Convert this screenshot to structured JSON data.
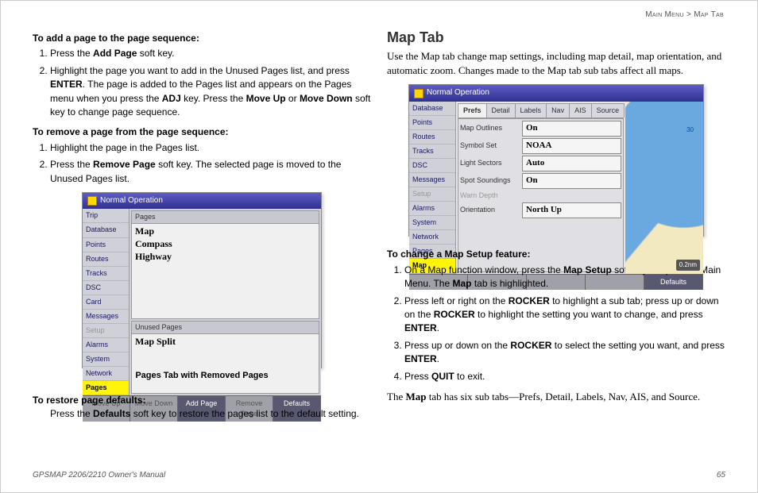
{
  "breadcrumb": {
    "left": "Main Menu",
    "sep": ">",
    "right": "Map Tab"
  },
  "left": {
    "addHead": "To add a page to the page sequence:",
    "add1_pre": "Press the ",
    "add1_b": "Add Page",
    "add1_post": " soft key.",
    "add2_a": "Highlight the page you want to add in the Unused Pages list, and press ",
    "add2_b": "ENTER",
    "add2_c": ". The page is added to the Pages list and appears on the Pages menu when you press the ",
    "add2_d": "ADJ",
    "add2_e": " key. Press the ",
    "add2_f": "Move Up",
    "add2_g": " or ",
    "add2_h": "Move Down",
    "add2_i": " soft key to change page sequence.",
    "remHead": "To remove a page from the page sequence:",
    "rem1": "Highlight the page in the Pages list.",
    "rem2_a": "Press the ",
    "rem2_b": "Remove Page",
    "rem2_c": " soft key. The selected page is moved to the Unused Pages list.",
    "restoreHead": "To restore page defaults:",
    "restore_a": "Press the ",
    "restore_b": "Defaults",
    "restore_c": " soft key to restore the pages list to the default setting.",
    "caption": "Pages Tab with Removed Pages"
  },
  "shot1": {
    "title": "Normal Operation",
    "side": [
      "Trip",
      "Database",
      "Points",
      "Routes",
      "Tracks",
      "DSC",
      "Card",
      "Messages",
      "Setup",
      "Alarms",
      "System",
      "Network",
      "Pages"
    ],
    "sideSel": "Pages",
    "sideDim": "Setup",
    "pagesH": "Pages",
    "pages": [
      "Map",
      "Compass",
      "Highway"
    ],
    "unusedH": "Unused Pages",
    "unused": [
      "Map Split"
    ],
    "btns": [
      "Move Up",
      "Move Down",
      "Add Page",
      "Remove Page",
      "Defaults"
    ],
    "btnsEnabled": [
      "Add Page",
      "Defaults"
    ]
  },
  "right": {
    "title": "Map Tab",
    "intro": "Use the Map tab change map settings, including map detail, map orientation, and automatic zoom. Changes made to the Map tab sub tabs affect all maps.",
    "chgHead": "To change a Map Setup feature:",
    "s1_a": "On a Map function window, press the ",
    "s1_b": "Map Setup",
    "s1_c": " soft key to open the Main Menu. The ",
    "s1_d": "Map",
    "s1_e": " tab is highlighted.",
    "s2_a": "Press left or right on the ",
    "s2_b": "ROCKER",
    "s2_c": " to highlight a sub tab; press up or down on the ",
    "s2_d": "ROCKER",
    "s2_e": " to highlight the setting you want to change, and press ",
    "s2_f": "ENTER",
    "s2_g": ".",
    "s3_a": "Press up or down on the ",
    "s3_b": "ROCKER",
    "s3_c": " to select the setting you want, and press ",
    "s3_d": "ENTER",
    "s3_e": ".",
    "s4_a": "Press ",
    "s4_b": "QUIT",
    "s4_c": " to exit.",
    "last_a": "The ",
    "last_b": "Map",
    "last_c": " tab has six sub tabs—Prefs, Detail, Labels, Nav, AIS, and Source."
  },
  "shot2": {
    "title": "Normal Operation",
    "side": [
      "Database",
      "Points",
      "Routes",
      "Tracks",
      "DSC",
      "Messages",
      "Setup",
      "Alarms",
      "System",
      "Network",
      "Pages",
      "Map"
    ],
    "sideSel": "Map",
    "sideDim": "Setup",
    "tabs": [
      "Prefs",
      "Detail",
      "Labels",
      "Nav",
      "AIS",
      "Source"
    ],
    "tabSel": "Prefs",
    "settings": [
      {
        "lab": "Map Outlines",
        "val": "On"
      },
      {
        "lab": "Symbol Set",
        "val": "NOAA"
      },
      {
        "lab": "Light Sectors",
        "val": "Auto"
      },
      {
        "lab": "Spot Soundings",
        "val": "On"
      },
      {
        "lab": "Warn Depth",
        "val": "",
        "dim": true
      },
      {
        "lab": "Orientation",
        "val": "North Up"
      }
    ],
    "btns": [
      "",
      "",
      "",
      "",
      "Defaults"
    ],
    "scale": "0.2nm",
    "soundings": [
      "30"
    ]
  },
  "footer": {
    "manual": "GPSMAP 2206/2210 Owner's Manual",
    "page": "65"
  }
}
